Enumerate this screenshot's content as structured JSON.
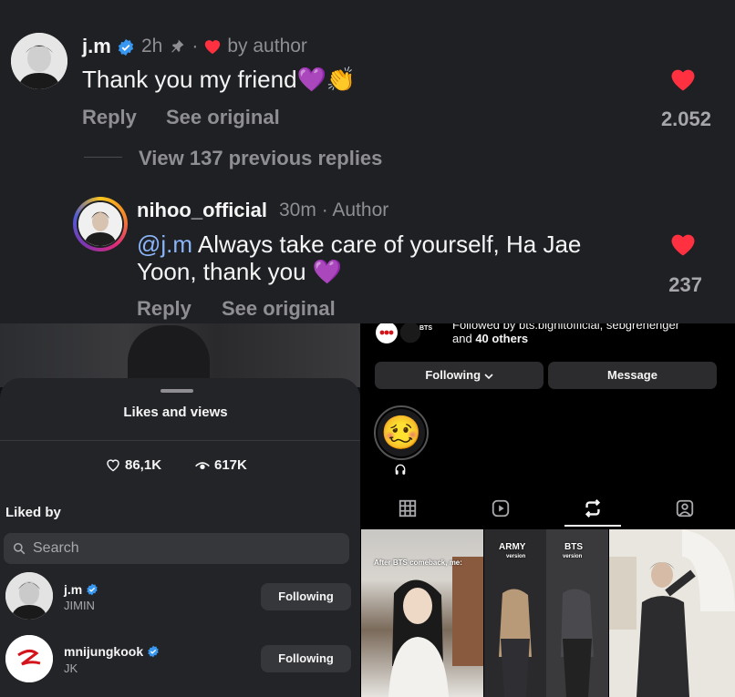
{
  "top_comment": {
    "username": "j.m",
    "time": "2h",
    "liked_by_author": "by author",
    "text": "Thank you my friend",
    "emoji": "💜👏",
    "actions": {
      "reply": "Reply",
      "see_original": "See original"
    },
    "like_count": "2.052"
  },
  "view_replies": "View 137 previous replies",
  "reply_comment": {
    "username": "nihoo_official",
    "time": "30m",
    "badge": "Author",
    "mention": "@j.m",
    "text_line1": " Always take care of yourself, Ha Jae",
    "text_line2": "Yoon, thank you",
    "emoji": "💜",
    "actions": {
      "reply": "Reply",
      "see_original": "See original"
    },
    "like_count": "237"
  },
  "likes_sheet": {
    "title": "Likes and views",
    "likes": "86,1K",
    "views": "617K",
    "liked_by_label": "Liked by",
    "search_placeholder": "Search",
    "users": [
      {
        "name": "j.m",
        "subtitle": "JIMIN",
        "button": "Following"
      },
      {
        "name": "mnijungkook",
        "subtitle": "JK",
        "button": "Following"
      }
    ]
  },
  "profile": {
    "badge_text": "BTS",
    "followed_by_line1": "Followed by bts.bighitofficial, sebgrenenger",
    "followed_by_line2_plain": "and ",
    "followed_by_line2_bold": "40 others",
    "following_button": "Following",
    "message_button": "Message",
    "highlight_emoji": "🥴",
    "thumbnails": [
      {
        "caption": "After BTS comeback, me:"
      },
      {
        "caption_a": "ARMY",
        "caption_a_sub": "version",
        "caption_b": "BTS",
        "caption_b_sub": "version"
      },
      {
        "caption": ""
      }
    ]
  },
  "colors": {
    "panel_bg": "#1f2024",
    "heart": "#ff3040",
    "verified": "#3897f0",
    "muted": "#8e8e93",
    "mention": "#8ab4f8"
  },
  "icons": [
    "pin-icon",
    "heart-icon",
    "verified-icon",
    "search-icon",
    "eye-icon",
    "grid-icon",
    "reels-icon",
    "reposts-icon",
    "tagged-icon",
    "headphones-icon"
  ]
}
